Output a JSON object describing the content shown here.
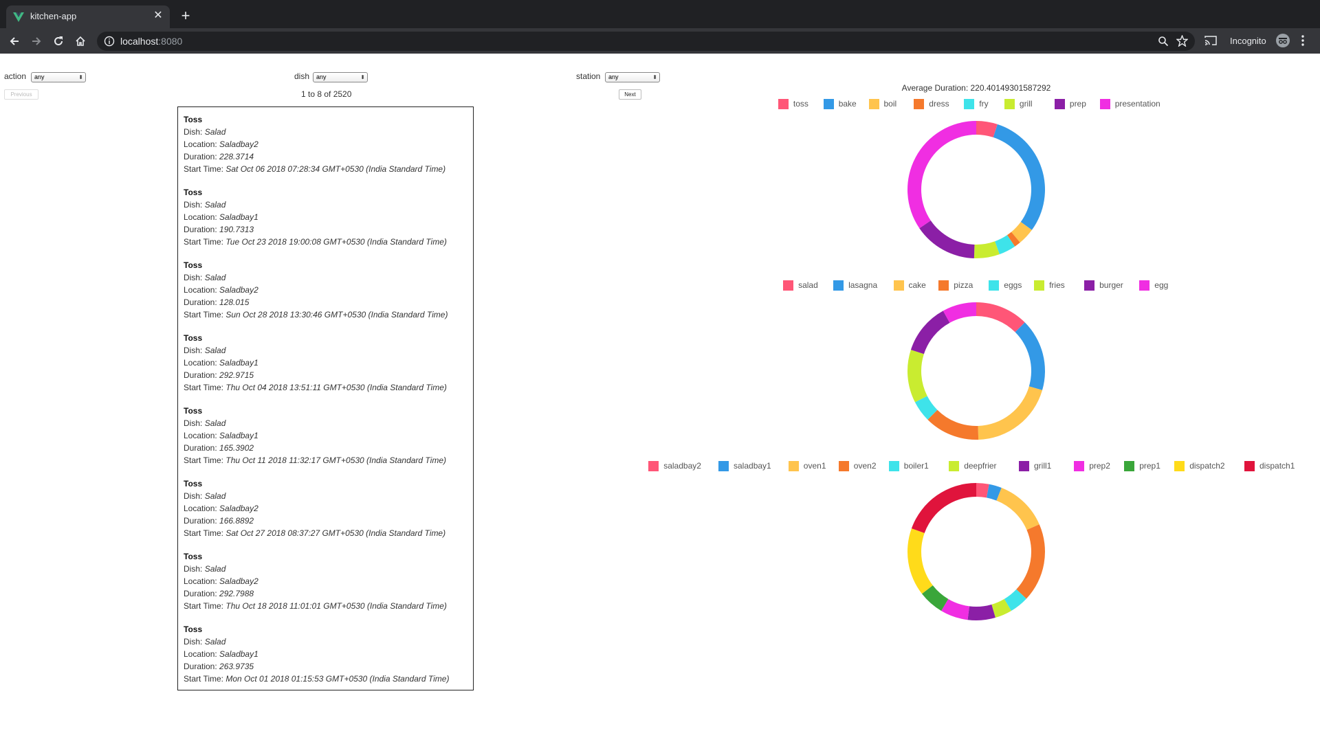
{
  "browser": {
    "tab_title": "kitchen-app",
    "url_host": "localhost",
    "url_port": ":8080",
    "incognito_label": "Incognito"
  },
  "filters": {
    "action": {
      "label": "action",
      "value": "any"
    },
    "dish": {
      "label": "dish",
      "value": "any"
    },
    "station": {
      "label": "station",
      "value": "any"
    }
  },
  "pagination": {
    "previous_label": "Previous",
    "next_label": "Next",
    "range_text": "1 to 8 of 2520"
  },
  "field_labels": {
    "dish": "Dish: ",
    "location": "Location: ",
    "duration": "Duration: ",
    "start_time": "Start Time: "
  },
  "records": [
    {
      "action": "Toss",
      "dish": "Salad",
      "location": "Saladbay2",
      "duration": "228.3714",
      "start_time": "Sat Oct 06 2018 07:28:34 GMT+0530 (India Standard Time)"
    },
    {
      "action": "Toss",
      "dish": "Salad",
      "location": "Saladbay1",
      "duration": "190.7313",
      "start_time": "Tue Oct 23 2018 19:00:08 GMT+0530 (India Standard Time)"
    },
    {
      "action": "Toss",
      "dish": "Salad",
      "location": "Saladbay2",
      "duration": "128.015",
      "start_time": "Sun Oct 28 2018 13:30:46 GMT+0530 (India Standard Time)"
    },
    {
      "action": "Toss",
      "dish": "Salad",
      "location": "Saladbay1",
      "duration": "292.9715",
      "start_time": "Thu Oct 04 2018 13:51:11 GMT+0530 (India Standard Time)"
    },
    {
      "action": "Toss",
      "dish": "Salad",
      "location": "Saladbay1",
      "duration": "165.3902",
      "start_time": "Thu Oct 11 2018 11:32:17 GMT+0530 (India Standard Time)"
    },
    {
      "action": "Toss",
      "dish": "Salad",
      "location": "Saladbay2",
      "duration": "166.8892",
      "start_time": "Sat Oct 27 2018 08:37:27 GMT+0530 (India Standard Time)"
    },
    {
      "action": "Toss",
      "dish": "Salad",
      "location": "Saladbay2",
      "duration": "292.7988",
      "start_time": "Thu Oct 18 2018 11:01:01 GMT+0530 (India Standard Time)"
    },
    {
      "action": "Toss",
      "dish": "Salad",
      "location": "Saladbay1",
      "duration": "263.9735",
      "start_time": "Mon Oct 01 2018 01:15:53 GMT+0530 (India Standard Time)"
    }
  ],
  "average_duration_text": "Average Duration: 220.40149301587292",
  "chart_data": [
    {
      "type": "pie",
      "categories": [
        "toss",
        "bake",
        "boil",
        "dress",
        "fry",
        "grill",
        "prep",
        "presentation"
      ],
      "values": [
        5,
        30,
        4,
        1.5,
        4,
        6,
        15,
        34.5
      ],
      "colors": [
        "#ff5677",
        "#3399e6",
        "#ffc44d",
        "#f5792c",
        "#3ee3ea",
        "#c9ec30",
        "#8b1fa6",
        "#f02ee2"
      ],
      "legend": "top"
    },
    {
      "type": "pie",
      "categories": [
        "salad",
        "lasagna",
        "cake",
        "pizza",
        "eggs",
        "fries",
        "burger",
        "egg"
      ],
      "values": [
        12.5,
        17,
        20,
        13,
        5,
        12.5,
        12,
        8
      ],
      "colors": [
        "#ff5677",
        "#3399e6",
        "#ffc44d",
        "#f5792c",
        "#3ee3ea",
        "#c9ec30",
        "#8b1fa6",
        "#f02ee2"
      ],
      "legend": "top"
    },
    {
      "type": "pie",
      "categories": [
        "saladbay2",
        "saladbay1",
        "oven1",
        "oven2",
        "boiler1",
        "deepfrier",
        "grill1",
        "prep2",
        "prep1",
        "dispatch2",
        "dispatch1"
      ],
      "values": [
        3,
        3,
        12.5,
        18.5,
        4.5,
        4,
        6.5,
        6.5,
        6,
        16,
        19.5
      ],
      "colors": [
        "#ff5677",
        "#3399e6",
        "#ffc44d",
        "#f5792c",
        "#3ee3ea",
        "#c9ec30",
        "#8b1fa6",
        "#f02ee2",
        "#3aa63a",
        "#ffdb1a",
        "#e0143c"
      ],
      "legend": "top"
    }
  ]
}
